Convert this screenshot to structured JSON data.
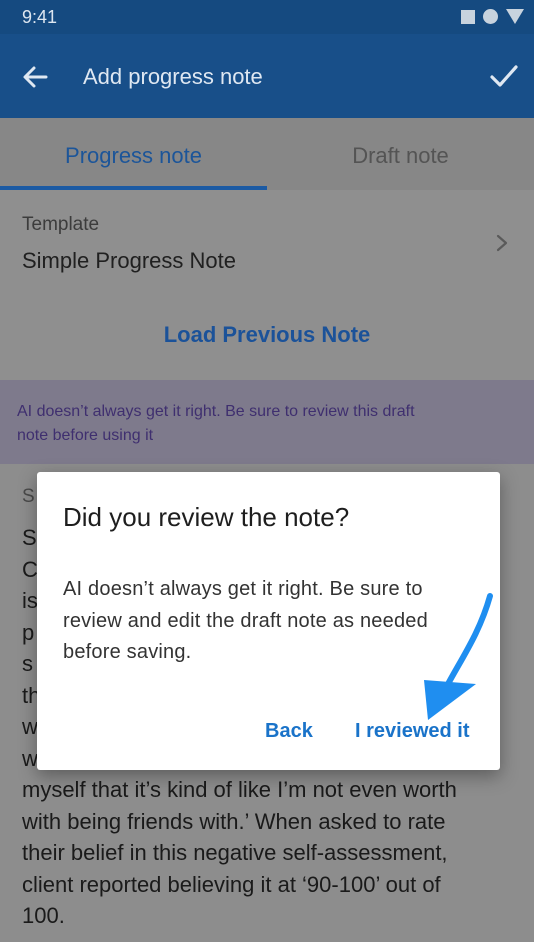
{
  "status_bar": {
    "time": "9:41",
    "icons": [
      "stop-square-icon",
      "dot-icon",
      "signal-triangle-icon"
    ]
  },
  "appbar": {
    "title": "Add progress note",
    "back_icon": "back-arrow-icon",
    "confirm_icon": "checkmark-icon"
  },
  "tabs": [
    {
      "label": "Progress note",
      "active": true
    },
    {
      "label": "Draft note",
      "active": false
    }
  ],
  "template": {
    "label": "Template",
    "value": "Simple Progress Note",
    "load_label": "Load Previous Note"
  },
  "banner": {
    "text": "AI doesn’t always get it right. Be sure to review this draft note before using it"
  },
  "content": {
    "section_initial": "S",
    "visible_text": "S\nC\nis\np\ns\nth\nw\nw\nmyself that it’s kind of like I’m not even worth\nwith being friends with.’ When asked to rate\ntheir belief in this negative self-assessment,\nclient reported believing it at ‘90-100’ out of\n100."
  },
  "dialog": {
    "title": "Did you review the note?",
    "message": "AI doesn’t always get it right. Be sure to review and edit the draft note as needed before saving.",
    "back_label": "Back",
    "confirm_label": "I reviewed it"
  },
  "colors": {
    "appbar": "#184f89",
    "accent": "#1a73c9",
    "pointer": "#1f8ef0"
  }
}
